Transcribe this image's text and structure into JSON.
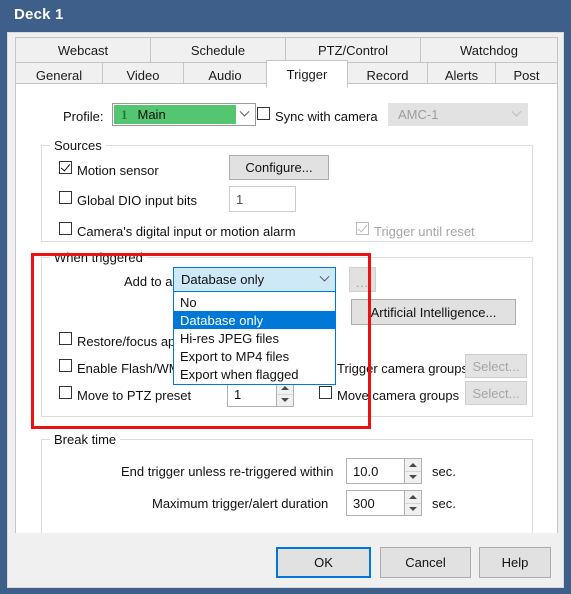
{
  "window": {
    "title": "Deck 1"
  },
  "tabs": {
    "top_row": [
      {
        "label": "Webcast"
      },
      {
        "label": "Schedule"
      },
      {
        "label": "PTZ/Control"
      },
      {
        "label": "Watchdog"
      }
    ],
    "bottom_row": [
      {
        "label": "General",
        "selected": false
      },
      {
        "label": "Video",
        "selected": false
      },
      {
        "label": "Audio",
        "selected": false
      },
      {
        "label": "Trigger",
        "selected": true
      },
      {
        "label": "Record",
        "selected": false
      },
      {
        "label": "Alerts",
        "selected": false
      },
      {
        "label": "Post",
        "selected": false
      }
    ]
  },
  "profile_row": {
    "label": "Profile:",
    "profile_number": "1",
    "profile_name": "Main",
    "sync_label": "Sync with camera",
    "sync_checked": false,
    "camera_value": "AMC-1"
  },
  "sources": {
    "title": "Sources",
    "motion_sensor_label": "Motion sensor",
    "motion_sensor_checked": true,
    "configure_button": "Configure...",
    "global_dio_label": "Global DIO input bits",
    "global_dio_checked": false,
    "global_dio_value": "1",
    "camera_digital_label": "Camera's digital input or motion alarm",
    "camera_digital_checked": false,
    "trigger_until_reset_label": "Trigger until reset",
    "trigger_until_reset_checked": true
  },
  "when_triggered": {
    "title": "When triggered",
    "add_to_alerts_label": "Add to alerts list:",
    "add_to_alerts_value": "Database only",
    "dots_button": "...",
    "dropdown_options": [
      {
        "label": "No",
        "selected": false
      },
      {
        "label": "Database only",
        "selected": true
      },
      {
        "label": "Hi-res JPEG files",
        "selected": false
      },
      {
        "label": "Export to MP4 files",
        "selected": false
      },
      {
        "label": "Export when flagged",
        "selected": false
      }
    ],
    "ai_button": "Artificial Intelligence...",
    "restore_focus_label": "Restore/focus app",
    "restore_focus_checked": false,
    "enable_flash_label": "Enable Flash/WM",
    "enable_flash_checked": false,
    "move_ptz_label": "Move to PTZ preset",
    "move_ptz_checked": false,
    "move_ptz_value": "1",
    "trigger_camera_groups_label": "Trigger camera groups",
    "trigger_camera_groups_checked": false,
    "trigger_select_button": "Select...",
    "move_camera_groups_label": "Move camera groups",
    "move_camera_groups_checked": false,
    "move_select_button": "Select..."
  },
  "break_time": {
    "title": "Break time",
    "end_trigger_label": "End trigger unless re-triggered within",
    "end_trigger_value": "10.0",
    "end_trigger_unit": "sec.",
    "max_duration_label": "Maximum trigger/alert duration",
    "max_duration_value": "300",
    "max_duration_unit": "sec."
  },
  "footer": {
    "ok": "OK",
    "cancel": "Cancel",
    "help": "Help"
  },
  "colors": {
    "titlebar": "#3e5f8a",
    "accent": "#0078d7",
    "profile_green": "#54c571",
    "highlight_red": "#ee1111"
  }
}
